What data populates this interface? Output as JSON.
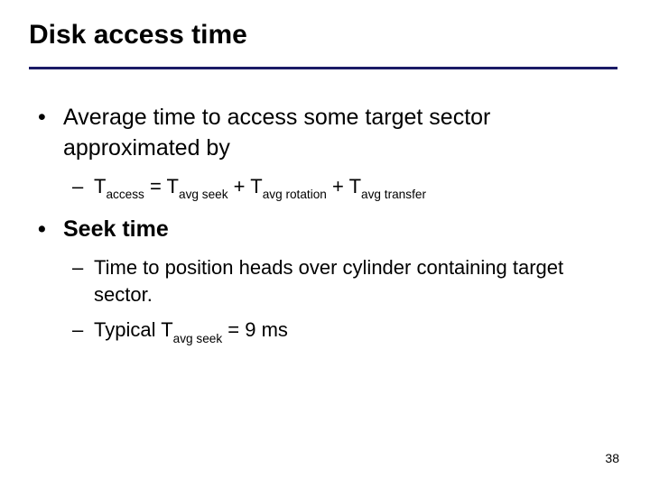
{
  "title": "Disk access time",
  "bullets": {
    "b1": "Average time to access some target sector approximated by",
    "b1a_T": "T",
    "b1a_access": "access",
    "b1a_eq": " = ",
    "b1a_Ta": "T",
    "b1a_avgseek": "avg seek",
    "b1a_plus1": " + ",
    "b1a_Tb": "T",
    "b1a_avgrot": "avg rotation",
    "b1a_plus2": " + ",
    "b1a_Tc": "T",
    "b1a_avgtrans": "avg transfer",
    "b2": "Seek time",
    "b2a": "Time to position heads over cylinder containing target sector.",
    "b2b_pre": "Typical  ",
    "b2b_T": "T",
    "b2b_avgseek": "avg seek",
    "b2b_post": " = 9 ms"
  },
  "page_number": "38"
}
